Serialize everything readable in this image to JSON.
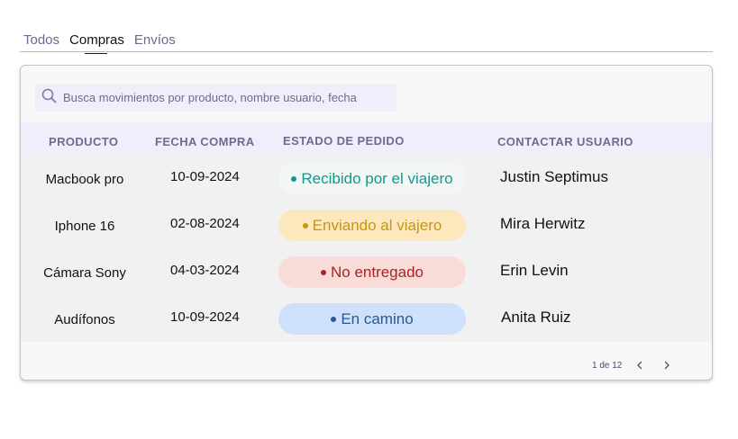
{
  "tabs": [
    {
      "label": "Todos",
      "active": false
    },
    {
      "label": "Compras",
      "active": true
    },
    {
      "label": "Envíos",
      "active": false
    }
  ],
  "search": {
    "placeholder": "Busca movimientos por producto, nombre usuario, fecha",
    "icon": "search-icon"
  },
  "table": {
    "headers": [
      "PRODUCTO",
      "FECHA COMPRA",
      "ESTADO DE PEDIDO",
      "CONTACTAR USUARIO"
    ],
    "rows": [
      {
        "product": "Macbook pro",
        "date": "10-09-2024",
        "status": "Recibido por el viajero",
        "status_color": "#13998a",
        "status_bg": "#f2f6f5",
        "user": "Justin Septimus"
      },
      {
        "product": "Iphone 16",
        "date": "02-08-2024",
        "status": "Enviando al viajero",
        "status_color": "#c7960f",
        "status_bg": "#fde8bd",
        "user": "Mira Herwitz"
      },
      {
        "product": "Cámara Sony",
        "date": "04-03-2024",
        "status": "No entregado",
        "status_color": "#a82424",
        "status_bg": "#f9dcd8",
        "user": "Erin Levin"
      },
      {
        "product": "Audífonos",
        "date": "10-09-2024",
        "status": "En camino",
        "status_color": "#255a92",
        "status_bg": "#cfe0fd",
        "user": "Anita Ruiz"
      }
    ]
  },
  "pagination": {
    "label": "1 de 12",
    "prev_icon": "chevron-left-icon",
    "next_icon": "chevron-right-icon"
  }
}
